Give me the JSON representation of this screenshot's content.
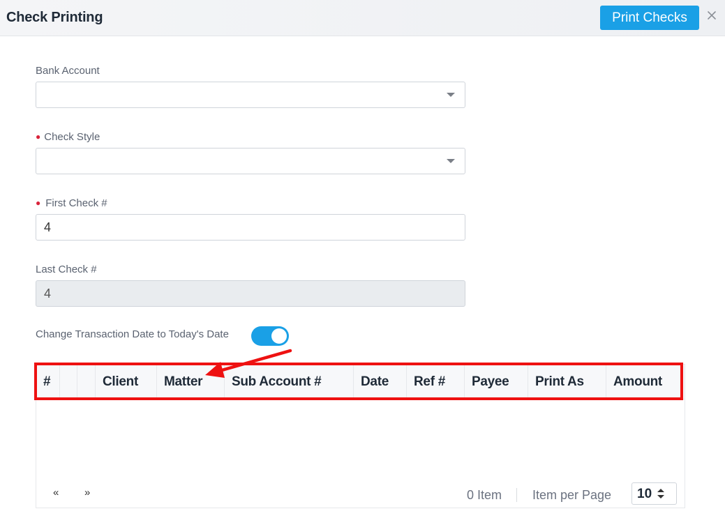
{
  "header": {
    "title": "Check Printing",
    "print_button": "Print Checks",
    "close_icon": "close-icon"
  },
  "form": {
    "bank_account": {
      "label": "Bank Account",
      "value": ""
    },
    "check_style": {
      "label": "Check Style",
      "required": true,
      "value": ""
    },
    "first_check": {
      "label": "First Check #",
      "required": true,
      "value": "4"
    },
    "last_check": {
      "label": "Last Check #",
      "value": "4",
      "disabled": true
    },
    "change_date": {
      "label": "Change Transaction Date to Today's Date",
      "enabled": true
    }
  },
  "table": {
    "columns": [
      "#",
      "",
      "",
      "Client",
      "Matter",
      "Sub Account #",
      "Date",
      "Ref #",
      "Payee",
      "Print As",
      "Amount"
    ],
    "rows": []
  },
  "pager": {
    "prev": "«",
    "next": "»",
    "item_count": "0 Item",
    "per_page_label": "Item per Page",
    "per_page_value": "10"
  },
  "colors": {
    "accent": "#1aa0e6",
    "annotation": "#ee1111",
    "required": "#d9233a"
  }
}
